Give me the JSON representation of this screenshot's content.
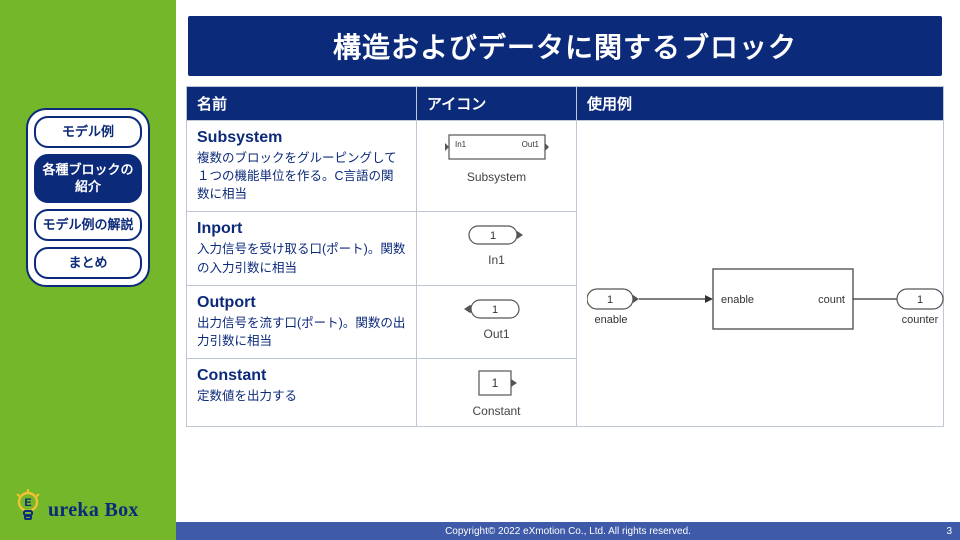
{
  "nav": {
    "items": [
      {
        "label": "モデル例",
        "active": false
      },
      {
        "label": "各種ブロックの紹介",
        "active": true
      },
      {
        "label": "モデル例の解説",
        "active": false
      },
      {
        "label": "まとめ",
        "active": false
      }
    ]
  },
  "logo": {
    "text": "ureka Box"
  },
  "title": "構造およびデータに関するブロック",
  "table": {
    "headers": {
      "name": "名前",
      "icon": "アイコン",
      "usage": "使用例"
    },
    "rows": [
      {
        "title": "Subsystem",
        "desc": "複数のブロックをグルーピングして１つの機能単位を作る。C言語の関数に相当",
        "icon_label": "Subsystem",
        "port_in": "In1",
        "port_out": "Out1"
      },
      {
        "title": "Inport",
        "desc": "入力信号を受け取る口(ポート)。関数の入力引数に相当",
        "icon_label": "In1",
        "port_num": "1"
      },
      {
        "title": "Outport",
        "desc": "出力信号を流す口(ポート)。関数の出力引数に相当",
        "icon_label": "Out1",
        "port_num": "1"
      },
      {
        "title": "Constant",
        "desc": "定数値を出力する",
        "icon_label": "Constant",
        "value": "1"
      }
    ],
    "usage": {
      "inport_num": "1",
      "inport_label": "enable",
      "block_in": "enable",
      "block_out": "count",
      "outport_num": "1",
      "outport_label": "counter"
    }
  },
  "footer": {
    "copyright": "Copyright© 2022 eXmotion Co., Ltd. All rights reserved.",
    "page": "3"
  }
}
